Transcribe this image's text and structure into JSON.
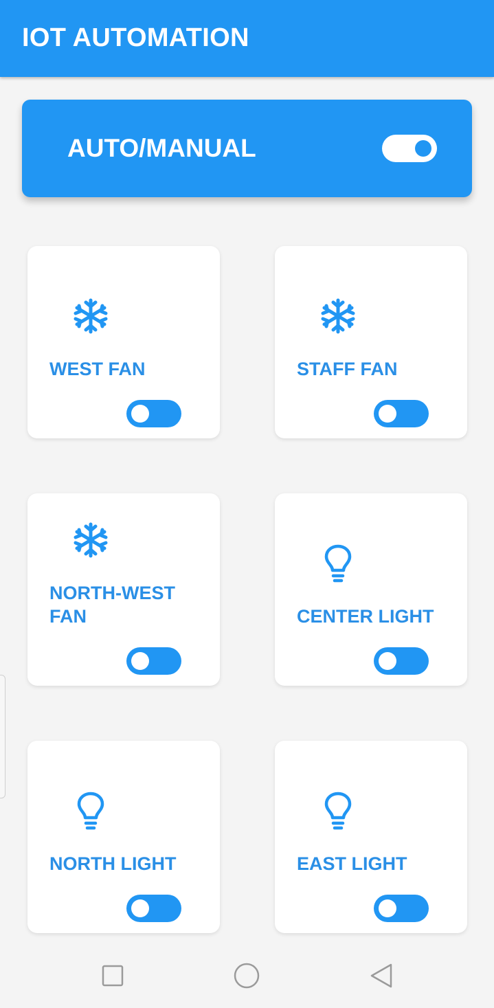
{
  "app": {
    "title": "IOT AUTOMATION"
  },
  "mode": {
    "label": "AUTO/MANUAL",
    "on": true
  },
  "devices": [
    {
      "label": "WEST FAN",
      "icon": "snowflake-icon",
      "on": false
    },
    {
      "label": "STAFF FAN",
      "icon": "snowflake-icon",
      "on": false
    },
    {
      "label": "NORTH-WEST FAN",
      "icon": "snowflake-icon",
      "on": false
    },
    {
      "label": "CENTER LIGHT",
      "icon": "lightbulb-icon",
      "on": false
    },
    {
      "label": "NORTH LIGHT",
      "icon": "lightbulb-icon",
      "on": false
    },
    {
      "label": "EAST LIGHT",
      "icon": "lightbulb-icon",
      "on": false
    }
  ],
  "navigation": [
    "recents-icon",
    "home-icon",
    "back-icon"
  ],
  "colors": {
    "primary": "#2196f3",
    "background": "#f4f4f4",
    "card": "#ffffff",
    "label": "#2a8fe6"
  }
}
